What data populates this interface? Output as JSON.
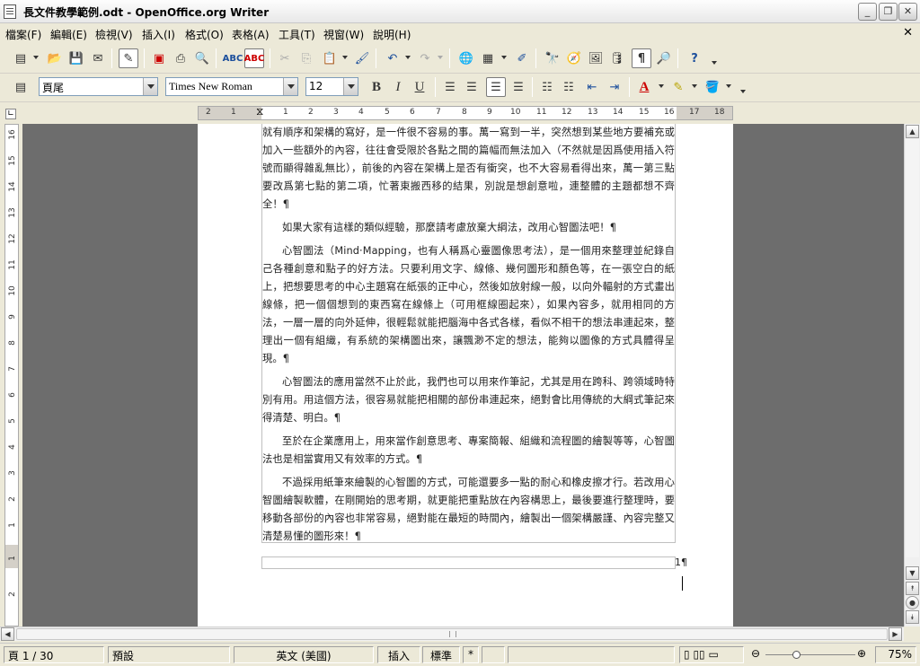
{
  "window": {
    "title": "長文件教學範例.odt - OpenOffice.org Writer"
  },
  "menu": {
    "items": [
      "檔案(F)",
      "編輯(E)",
      "檢視(V)",
      "插入(I)",
      "格式(O)",
      "表格(A)",
      "工具(T)",
      "視窗(W)",
      "說明(H)"
    ]
  },
  "formatting": {
    "paragraph_style": "頁尾",
    "font_name": "Times New Roman",
    "font_size": "12"
  },
  "ruler": {
    "h_ticks": [
      "2",
      "1",
      "1",
      "2",
      "3",
      "4",
      "5",
      "6",
      "7",
      "8",
      "9",
      "10",
      "11",
      "12",
      "13",
      "14",
      "15",
      "16",
      "17",
      "18"
    ],
    "v_ticks": [
      "16",
      "15",
      "14",
      "13",
      "12",
      "11",
      "10",
      "9",
      "8",
      "7",
      "6",
      "5",
      "4",
      "3",
      "2",
      "1",
      "1",
      "2"
    ]
  },
  "document": {
    "paragraphs": [
      "就有順序和架構的寫好，是一件很不容易的事。萬一寫到一半，突然想到某些地方要補充或加入一些額外的內容，往往會受限於各點之間的篇幅而無法加入（不然就是因爲使用插入符號而顯得雜亂無比），前後的內容在架構上是否有衝突，也不大容易看得出來，萬一第三點要改爲第七點的第二項，忙著東搬西移的結果，別說是想創意啦，連整體的主題都想不齊全！¶",
      "如果大家有這樣的類似經驗，那麼請考慮放棄大綱法，改用心智圖法吧！¶",
      "心智圖法（Mind·Mapping，也有人稱爲心靈圖像思考法），是一個用來整理並紀錄自己各種創意和點子的好方法。只要利用文字、線條、幾何圖形和顏色等，在一張空白的紙上，把想要思考的中心主題寫在紙張的正中心，然後如放射線一般，以向外輻射的方式畫出線條，把一個個想到的東西寫在線條上（可用框線圈起來），如果內容多，就用相同的方法，一層一層的向外延伸，很輕鬆就能把腦海中各式各樣，看似不相干的想法串連起來，整理出一個有組織，有系統的架構圖出來，讓飄渺不定的想法，能夠以圖像的方式具體得呈現。¶",
      "心智圖法的應用當然不止於此，我們也可以用來作筆記，尤其是用在跨科、跨領域時特別有用。用這個方法，很容易就能把相關的部份串連起來，絕對會比用傳統的大綱式筆記來得清楚、明白。¶",
      "至於在企業應用上，用來當作創意思考、專案簡報、組織和流程圖的繪製等等，心智圖法也是相當實用又有效率的方式。¶",
      "不過採用紙筆來繪製的心智圖的方式，可能還要多一點的耐心和橡皮擦才行。若改用心智圖繪製軟體，在剛開始的思考期，就更能把重點放在內容構思上，最後要進行整理時，要移動各部份的內容也非常容易，絕對能在最短的時間內，繪製出一個架構嚴謹、內容完整又清楚易懂的圖形來！¶"
    ],
    "footer_text": "1¶"
  },
  "status": {
    "page": "頁 1 / 30",
    "page_style": "預設",
    "language": "英文 (美國)",
    "insert_mode": "插入",
    "selection_mode": "標準",
    "modified": "*",
    "zoom": "75%"
  }
}
